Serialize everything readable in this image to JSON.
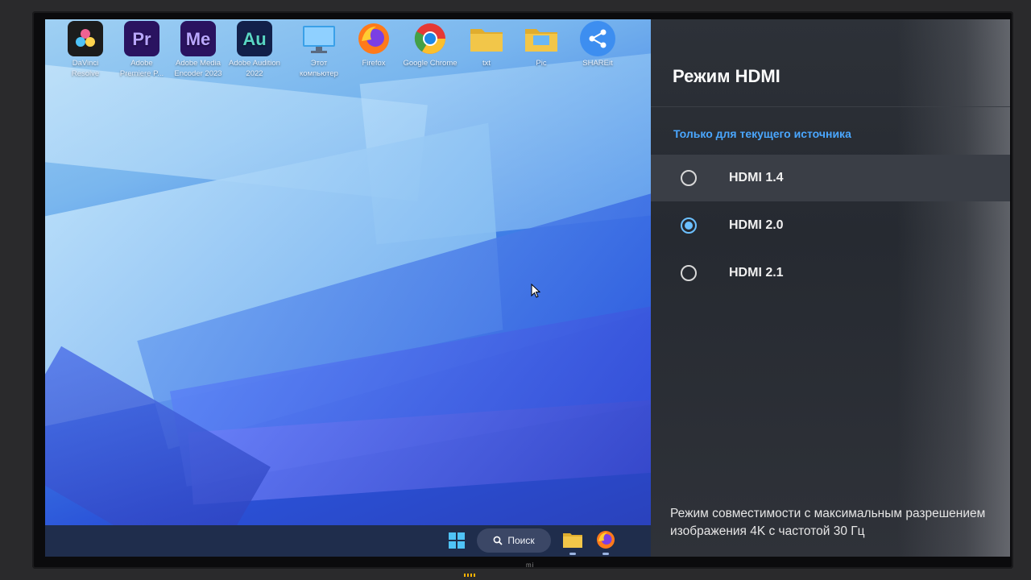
{
  "desktop": {
    "icons": [
      {
        "label": "DaVinci Resolve",
        "icon": "davinci-resolve-icon",
        "color": "#1c1c1c"
      },
      {
        "label": "Adobe Premiere P...",
        "icon": "premiere-icon",
        "glyph": "Pr",
        "color": "#2a1360"
      },
      {
        "label": "Adobe Media Encoder 2023",
        "icon": "media-encoder-icon",
        "glyph": "Me",
        "color": "#2a1360"
      },
      {
        "label": "Adobe Audition 2022",
        "icon": "audition-icon",
        "glyph": "Au",
        "color": "#12204a"
      },
      {
        "label": "Этот компьютер",
        "icon": "this-pc-icon",
        "color": "#3aa0e8"
      },
      {
        "label": "Firefox",
        "icon": "firefox-icon",
        "color": "#ff7a1a"
      },
      {
        "label": "Google Chrome",
        "icon": "chrome-icon",
        "color": "#e53935"
      },
      {
        "label": "txt",
        "icon": "folder-icon",
        "color": "#f2c649"
      },
      {
        "label": "Pic",
        "icon": "folder-icon",
        "color": "#f2c649"
      },
      {
        "label": "SHAREit",
        "icon": "shareit-icon",
        "color": "#3d8ef0"
      }
    ],
    "taskbar": {
      "search_label": "Поиск"
    }
  },
  "panel": {
    "title": "Режим HDMI",
    "subtitle": "Только для текущего источника",
    "options": [
      {
        "label": "HDMI 1.4",
        "selected": false,
        "focused": true
      },
      {
        "label": "HDMI 2.0",
        "selected": true,
        "focused": false
      },
      {
        "label": "HDMI 2.1",
        "selected": false,
        "focused": false
      }
    ],
    "description": "Режим совместимости с максимальным разрешением изображения 4K с частотой 30 Гц",
    "accent_color": "#4aa7ff"
  },
  "tv": {
    "logo": "mi"
  }
}
